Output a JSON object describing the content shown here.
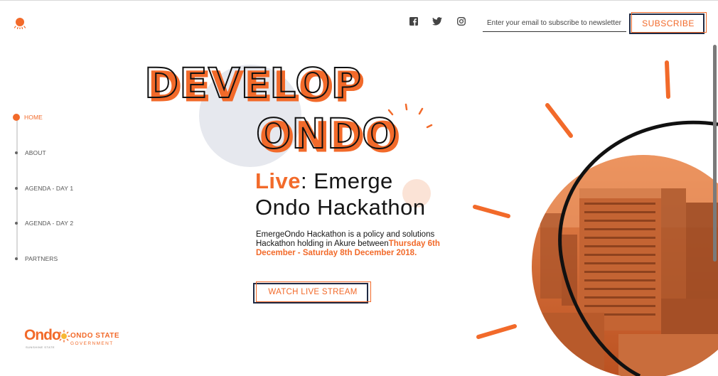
{
  "colors": {
    "accent": "#f26a2a",
    "navy": "#1f2a44",
    "text": "#151515",
    "bubble": "#e6e8ee"
  },
  "header": {
    "logo_icon": "sun-logo-icon",
    "social": [
      {
        "name": "facebook-icon"
      },
      {
        "name": "twitter-icon"
      },
      {
        "name": "instagram-icon"
      }
    ],
    "email_placeholder": "Enter your email to subscribe to newsletter",
    "email_value": "",
    "subscribe_label": "SUBSCRIBE"
  },
  "nav": {
    "items": [
      {
        "label": "HOME",
        "active": true
      },
      {
        "label": "ABOUT",
        "active": false
      },
      {
        "label": "AGENDA - DAY 1",
        "active": false
      },
      {
        "label": "AGENDA - DAY 2",
        "active": false
      },
      {
        "label": "PARTNERS",
        "active": false
      }
    ]
  },
  "hero": {
    "title_line1": "DEVELOP",
    "title_line2": "ONDO",
    "live_word": "Live",
    "headline_rest": ": Emerge",
    "headline_line2": "Ondo Hackathon",
    "description": "EmergeOndo Hackathon is a policy and solutions Hackathon holding in Akure between",
    "date_text": "Thursday 6th December - Saturday 8th December 2018.",
    "cta_label": "WATCH LIVE STREAM",
    "image_name": "akure-city-photo"
  },
  "footer_logo": {
    "word": "Ondo",
    "tagline": "SUNSHINE STATE",
    "state": "ONDO STATE",
    "government": "GOVERNMENT"
  }
}
